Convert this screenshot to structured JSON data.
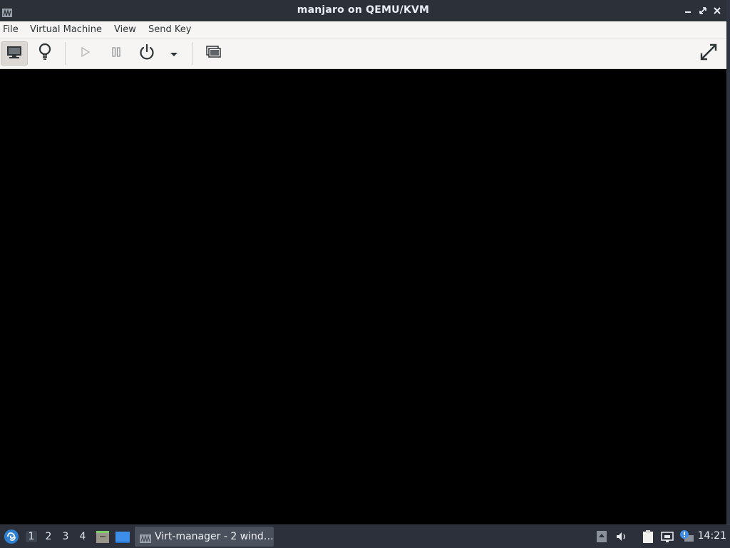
{
  "window": {
    "title": "manjaro on QEMU/KVM",
    "app_icon": "virt-manager-icon"
  },
  "menubar": {
    "items": [
      "File",
      "Virtual Machine",
      "View",
      "Send Key"
    ]
  },
  "toolbar": {
    "buttons": [
      {
        "name": "show-console-button",
        "icon": "monitor-icon",
        "active": true
      },
      {
        "name": "show-details-button",
        "icon": "lightbulb-icon"
      },
      {
        "name": "run-button",
        "icon": "play-icon",
        "disabled": true
      },
      {
        "name": "pause-button",
        "icon": "pause-icon"
      },
      {
        "name": "shutdown-button",
        "icon": "power-icon"
      },
      {
        "name": "shutdown-menu-button",
        "icon": "dropdown-arrow-icon"
      },
      {
        "name": "snapshots-button",
        "icon": "snapshots-icon"
      },
      {
        "name": "fullscreen-button",
        "icon": "fullscreen-icon"
      }
    ]
  },
  "taskbar": {
    "workspaces": [
      "1",
      "2",
      "3",
      "4"
    ],
    "active_workspace": "1",
    "task_label": "Virt-manager - 2 wind…",
    "clock": "14:21"
  },
  "colors": {
    "titlebar_bg": "#2c3138",
    "taskbar_bg": "#2b303a",
    "toolbar_bg": "#f6f5f4",
    "vm_screen": "#000000"
  }
}
